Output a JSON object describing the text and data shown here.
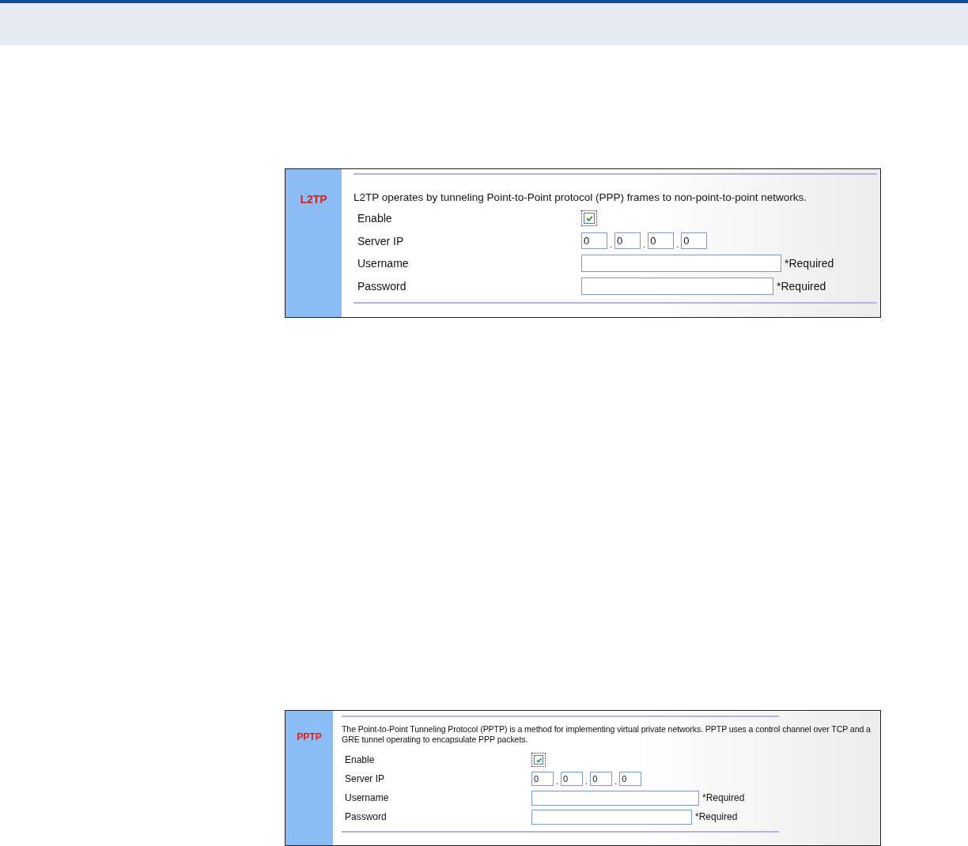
{
  "panels": [
    {
      "title": "L2TP",
      "description": "L2TP operates by tunneling Point-to-Point protocol (PPP) frames to non-point-to-point networks.",
      "fields": [
        {
          "label": "Enable",
          "kind": "checkbox",
          "checked": true
        },
        {
          "label": "Server IP",
          "kind": "ip",
          "separator": ".",
          "octets": [
            "0",
            "0",
            "0",
            "0"
          ]
        },
        {
          "label": "Username",
          "kind": "text",
          "note": "*Required"
        },
        {
          "label": "Password",
          "kind": "password",
          "note": "*Required"
        }
      ]
    },
    {
      "title": "PPTP",
      "description": "The Point-to-Point Tunneling Protocol (PPTP) is a method for implementing virtual private networks. PPTP uses a control channel over TCP and a GRE tunnel operating to encapsulate PPP packets.",
      "fields": [
        {
          "label": "Enable",
          "kind": "checkbox",
          "checked": true
        },
        {
          "label": "Server IP",
          "kind": "ip",
          "separator": ".",
          "octets": [
            "0",
            "0",
            "0",
            "0"
          ]
        },
        {
          "label": "Username",
          "kind": "text",
          "note": "*Required"
        },
        {
          "label": "Password",
          "kind": "password",
          "note": "*Required"
        }
      ]
    }
  ]
}
